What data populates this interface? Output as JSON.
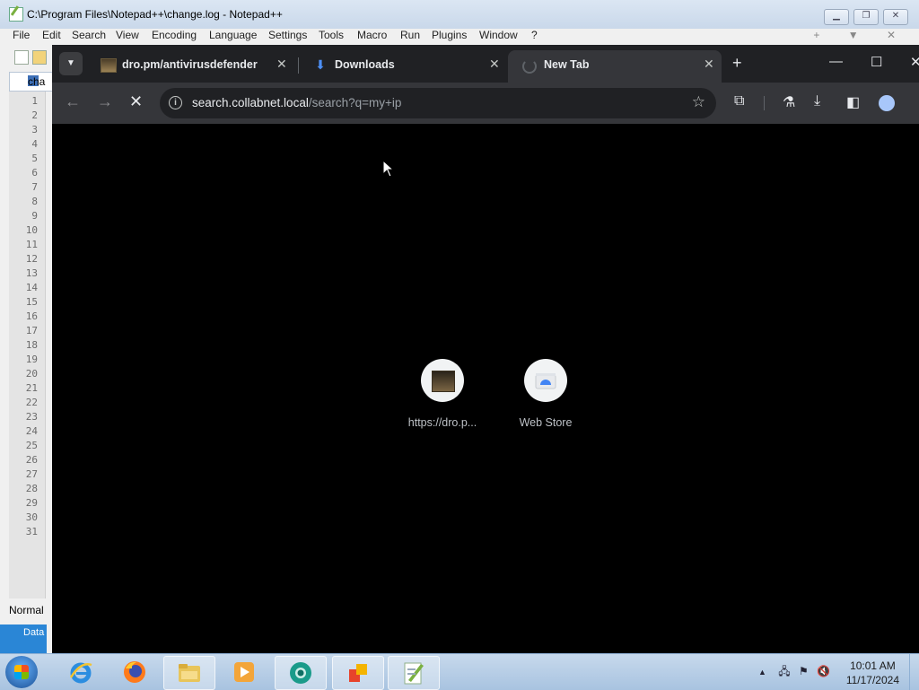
{
  "notepad": {
    "title": "C:\\Program Files\\Notepad++\\change.log - Notepad++",
    "menu": [
      "File",
      "Edit",
      "Search",
      "View",
      "Encoding",
      "Language",
      "Settings",
      "Tools",
      "Macro",
      "Run",
      "Plugins",
      "Window",
      "?"
    ],
    "menu_right": "+ ▼ ✕",
    "file_tab": "cha",
    "line_numbers": [
      "1",
      "2",
      "3",
      "4",
      "5",
      "6",
      "7",
      "8",
      "9",
      "10",
      "11",
      "12",
      "13",
      "14",
      "15",
      "16",
      "17",
      "18",
      "19",
      "20",
      "21",
      "22",
      "23",
      "24",
      "25",
      "26",
      "27",
      "28",
      "29",
      "30",
      "31"
    ],
    "status_mode": "Normal",
    "status_data": "Data"
  },
  "chrome": {
    "tabs": [
      {
        "label": "dro.pm/antivirusdefender",
        "icon": "site-favicon"
      },
      {
        "label": "Downloads",
        "icon": "download-icon"
      },
      {
        "label": "New Tab",
        "icon": "loading-spinner-icon"
      }
    ],
    "url_host": "search.collabnet.local",
    "url_path": "/search?q=my+ip",
    "shortcuts": [
      {
        "label": "https://dro.p...",
        "icon": "site-thumbnail"
      },
      {
        "label": "Web Store",
        "icon": "web-store-icon"
      }
    ]
  },
  "taskbar": {
    "time": "10:01 AM",
    "date": "11/17/2024",
    "tray_arrow": "▲"
  }
}
